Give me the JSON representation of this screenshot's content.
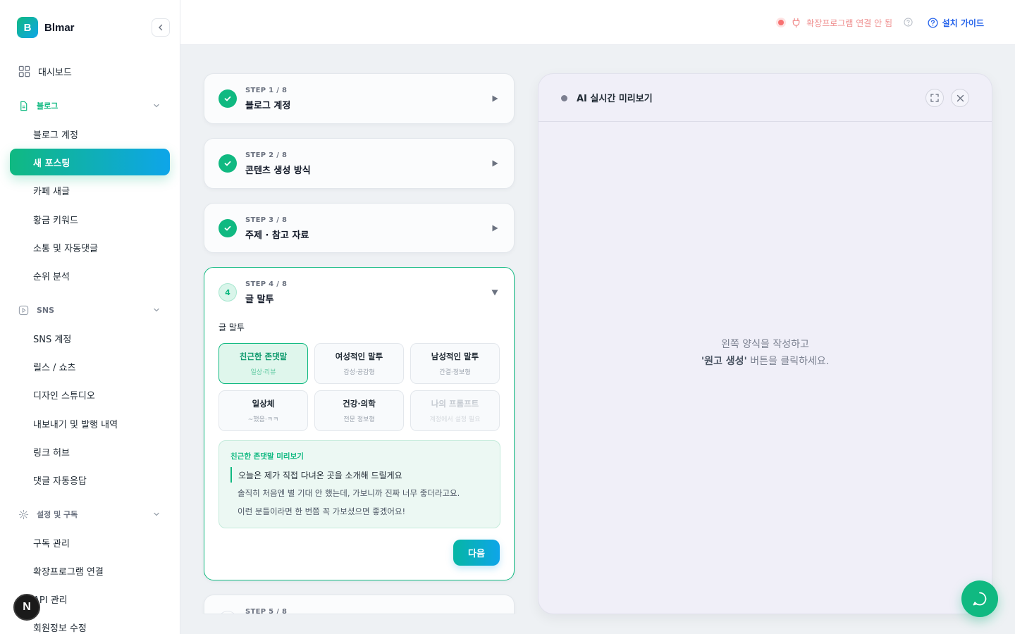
{
  "brand": {
    "logo_letter": "B",
    "name": "Blmar"
  },
  "sidebar": {
    "dashboard": "대시보드",
    "sections": [
      {
        "label": "블로그",
        "icon": "document-icon",
        "items": [
          "블로그 계정",
          "새 포스팅",
          "카페 새글",
          "황금 키워드",
          "소통 및 자동댓글",
          "순위 분석"
        ]
      },
      {
        "label": "SNS",
        "icon": "play-icon",
        "items": [
          "SNS 계정",
          "릴스 / 쇼츠",
          "디자인 스튜디오",
          "내보내기 및 발행 내역",
          "링크 허브",
          "댓글 자동응답"
        ]
      },
      {
        "label": "설정 및 구독",
        "icon": "gear-icon",
        "items": [
          "구독 관리",
          "확장프로그램 연결",
          "API 관리",
          "회원정보 수정"
        ]
      }
    ],
    "active_item": "새 포스팅",
    "n_badge": "N"
  },
  "topbar": {
    "extension_status": "확장프로그램 연결 안 됨",
    "guide": "설치 가이드"
  },
  "steps": [
    {
      "num": "STEP 1 / 8",
      "title": "블로그 계정",
      "state": "done"
    },
    {
      "num": "STEP 2 / 8",
      "title": "콘텐츠 생성 방식",
      "state": "done"
    },
    {
      "num": "STEP 3 / 8",
      "title": "주제 · 참고 자료",
      "state": "done"
    },
    {
      "num": "STEP 4 / 8",
      "title": "글 말투",
      "state": "open",
      "circle": "4"
    },
    {
      "num": "STEP 5 / 8",
      "title": "",
      "state": "pending"
    }
  ],
  "tone": {
    "field_label": "글 말투",
    "options": [
      {
        "title": "친근한 존댓말",
        "sub": "일상·리뷰",
        "selected": true
      },
      {
        "title": "여성적인 말투",
        "sub": "감성·공감형"
      },
      {
        "title": "남성적인 말투",
        "sub": "간결·정보형"
      },
      {
        "title": "일상체",
        "sub": "~했음·ㅋㅋ"
      },
      {
        "title": "건강·의학",
        "sub": "전문 정보형"
      },
      {
        "title": "나의 프롬프트",
        "sub": "계정에서 설정 필요",
        "disabled": true
      }
    ],
    "preview": {
      "title": "친근한 존댓말 미리보기",
      "line1": "오늘은 제가 직접 다녀온 곳을 소개해 드릴게요",
      "line2": "솔직히 처음엔 별 기대 안 했는데, 가보니까 진짜 너무 좋더라고요.",
      "line3": "이런 분들이라면 한 번쯤 꼭 가보셨으면 좋겠어요!"
    },
    "next": "다음"
  },
  "preview_panel": {
    "title": "AI 실시간 미리보기",
    "empty_line1": "왼쪽 양식을 작성하고",
    "empty_bold": "'원고 생성'",
    "empty_line2_rest": " 버튼을 클릭하세요."
  }
}
